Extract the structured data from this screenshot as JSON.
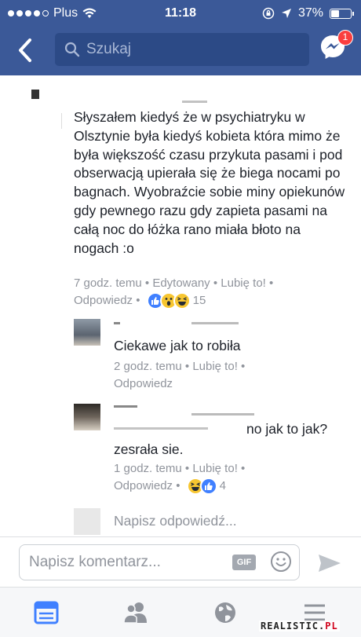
{
  "status_bar": {
    "carrier": "Plus",
    "time": "11:18",
    "battery": "37%",
    "battery_level": 0.37
  },
  "nav": {
    "search_placeholder": "Szukaj",
    "messenger_badge": "1"
  },
  "comment": {
    "text": "Słyszałem kiedyś że w psychiatryku w Olsztynie była kiedyś kobieta która mimo że była większość czasu przykuta pasami i pod obserwacją upierała się że biega nocami po bagnach. Wyobraźcie sobie miny opiekunów gdy pewnego razu gdy zapieta pasami na całą noc do łóżka rano miała błoto na nogach :o",
    "time": "7 godz. temu",
    "edited": "Edytowany",
    "like": "Lubię to!",
    "reply": "Odpowiedz",
    "reaction_count": "15",
    "reactions": [
      "like-icon",
      "wow-icon",
      "haha-icon"
    ]
  },
  "replies": [
    {
      "text": "Ciekawe jak to robiła",
      "time": "2 godz. temu",
      "like": "Lubię to!",
      "reply": "Odpowiedz"
    },
    {
      "text_line1": "no jak to jak?",
      "text_line2": "zesrała sie.",
      "time": "1 godz. temu",
      "like": "Lubię to!",
      "reply": "Odpowiedz",
      "reaction_count": "4",
      "reactions": [
        "haha-icon",
        "like-icon"
      ]
    }
  ],
  "write_reply_placeholder": "Napisz odpowiedź...",
  "composer": {
    "placeholder": "Napisz komentarz...",
    "gif_label": "GIF"
  },
  "tabs": [
    "news-feed-icon",
    "friends-icon",
    "globe-icon",
    "menu-icon"
  ],
  "watermark": {
    "main": "REALISTIC.",
    "suffix": "PL"
  },
  "colors": {
    "brand": "#3b5998",
    "accent": "#4080ff",
    "badge": "#fa3e3e"
  }
}
